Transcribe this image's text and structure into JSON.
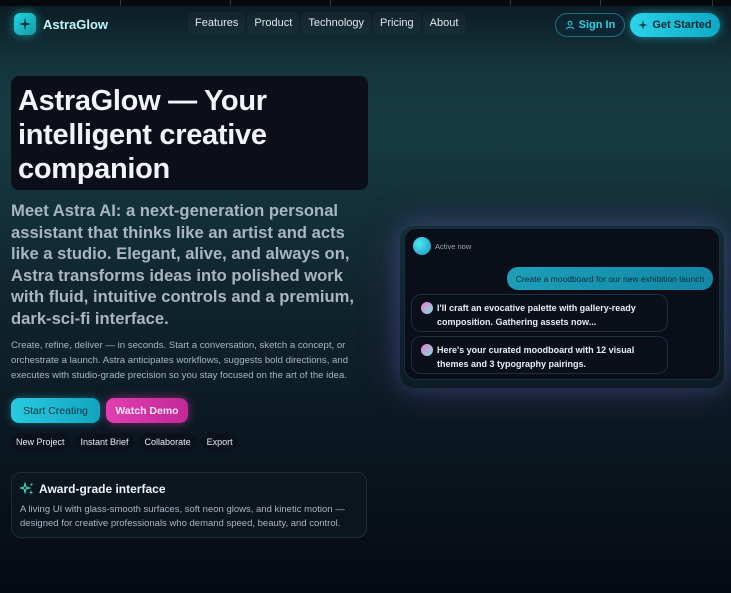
{
  "brand": {
    "name": "AstraGlow",
    "accent": "#22cfe4",
    "magenta": "#d9359f"
  },
  "nav": {
    "links": [
      "Features",
      "Product",
      "Technology",
      "Pricing",
      "About"
    ],
    "signin_label": "Sign In",
    "getstarted_label": "Get Started"
  },
  "hero": {
    "title_line1": "AstraGlow — Your",
    "title_line2": "intelligent creative",
    "title_line3": "companion",
    "lead": "Meet Astra AI: a next-generation personal assistant that thinks like an artist and acts like a studio. Elegant, alive, and always on, Astra transforms ideas into polished work with fluid, intuitive controls and a premium, dark-sci-fi interface.",
    "sub": "Create, refine, deliver — in seconds. Start a conversation, sketch a concept, or orchestrate a launch. Astra anticipates workflows, suggests bold directions, and executes with studio-grade precision so you stay focused on the art of the idea.",
    "cta_primary": "Start Creating",
    "cta_secondary": "Watch Demo",
    "chips": [
      "New Project",
      "Instant Brief",
      "Collaborate",
      "Export"
    ]
  },
  "feature": {
    "title": "Award-grade interface",
    "desc": "A living UI with glass-smooth surfaces, soft neon glows, and kinetic motion — designed for creative professionals who demand speed, beauty, and control."
  },
  "chat": {
    "status": "Active now",
    "user_message": "Create a moodboard for our new exhibition launch",
    "bot_messages": [
      "I'll craft an evocative palette with gallery-ready composition. Gathering assets now...",
      "Here's your curated moodboard with 12 visual themes and 3 typography pairings."
    ]
  }
}
